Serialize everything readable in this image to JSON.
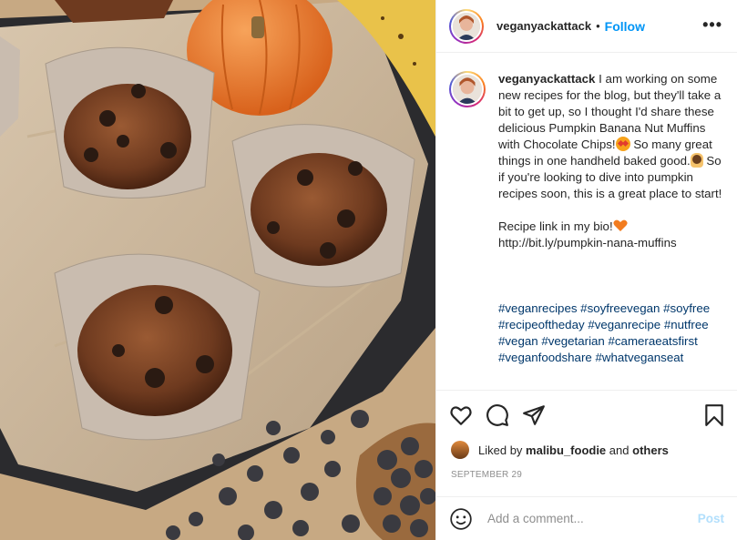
{
  "post": {
    "username": "veganyackattack",
    "separator": "•",
    "follow_label": "Follow",
    "more_label": "•••",
    "caption": {
      "username": "veganyackattack",
      "part1": "I am working on some new recipes for the blog, but they'll take a bit to get up, so I thought I'd share these delicious Pumpkin Banana Nut Muffins with Chocolate Chips!",
      "part2": "So many great things in one handheld baked good.",
      "part3": "So if you're looking to dive into pumpkin recipes soon, this is a great place to start!",
      "recipe_line": "Recipe link in my bio!",
      "link": "http://bit.ly/pumpkin-nana-muffins",
      "hashtags": "#veganrecipes #soyfreevegan #soyfree #recipeoftheday #veganrecipe #nutfree #vegan #vegetarian #cameraeatsfirst #veganfoodshare #whatveganseat"
    },
    "likes": {
      "prefix": "Liked by",
      "user": "malibu_foodie",
      "and": "and",
      "others": "others"
    },
    "date": "SEPTEMBER 29",
    "comment": {
      "placeholder": "Add a comment...",
      "post_label": "Post"
    }
  },
  "colors": {
    "accent": "#0095f6",
    "hashtag": "#00376b",
    "post_disabled": "#b2dffc",
    "heart_emoji": "#f27c1f"
  },
  "icons": [
    "heart-icon",
    "comment-icon",
    "share-icon",
    "bookmark-icon",
    "emoji-icon",
    "more-options-icon"
  ]
}
